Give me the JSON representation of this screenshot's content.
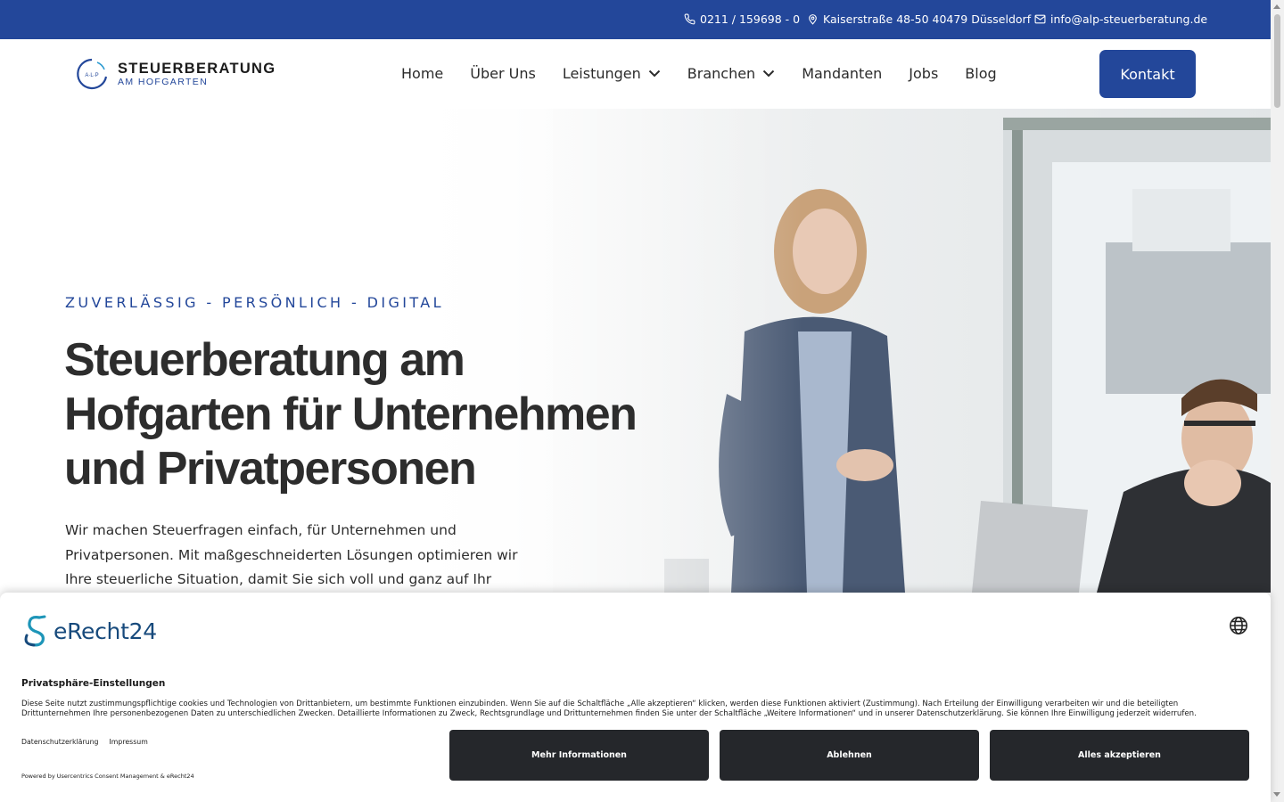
{
  "colors": {
    "primary": "#23479a",
    "dark_button": "#25272b",
    "brand_teal": "#174a7c"
  },
  "topbar": {
    "phone": "0211 / 159698 - 0",
    "address": "Kaiserstraße 48-50 40479 Düsseldorf",
    "email": "info@alp-steuerberatung.de",
    "icons": {
      "phone": "phone-icon",
      "address": "map-pin-icon",
      "email": "mail-icon"
    }
  },
  "logo": {
    "monogram": "A·L·P",
    "line1": "STEUERBERATUNG",
    "line2": "AM HOFGARTEN"
  },
  "nav": {
    "items": [
      {
        "label": "Home"
      },
      {
        "label": "Über Uns"
      },
      {
        "label": "Leistungen",
        "dropdown": true
      },
      {
        "label": "Branchen",
        "dropdown": true
      },
      {
        "label": "Mandanten"
      },
      {
        "label": "Jobs"
      },
      {
        "label": "Blog"
      }
    ],
    "cta": "Kontakt"
  },
  "hero": {
    "eyebrow": "ZUVERLÄSSIG - PERSÖNLICH - DIGITAL",
    "title": "Steuerberatung am Hofgarten für Unternehmen und Privatpersonen",
    "text": "Wir machen Steuerfragen einfach, für Unternehmen und Privatpersonen. Mit maßgeschneiderten Lösungen optimieren wir Ihre steuerliche Situation, damit Sie sich voll und ganz auf Ihr"
  },
  "consent": {
    "brand": "eRecht24",
    "title": "Privatsphäre-Einstellungen",
    "text": "Diese Seite nutzt zustimmungspflichtige cookies und Technologien von Drittanbietern, um bestimmte Funktionen einzubinden. Wenn Sie auf die Schaltfläche „Alle akzeptieren“ klicken, werden diese Funktionen aktiviert (Zustimmung). Nach Erteilung der Einwilligung verarbeiten wir und die beteiligten Drittunternehmen Ihre personenbezogenen Daten zu unterschiedlichen Zwecken. Detaillierte Informationen zu Zweck, Rechtsgrundlage und Drittunternehmen finden Sie unter der Schaltfläche „Weitere Informationen“ und in unserer Datenschutzerklärung. Sie können Ihre Einwilligung jederzeit widerrufen.",
    "link_privacy": "Datenschutzerklärung",
    "link_imprint": "Impressum",
    "powered": "Powered by Usercentrics Consent Management & eRecht24",
    "btn_more": "Mehr Informationen",
    "btn_decline": "Ablehnen",
    "btn_accept": "Alles akzeptieren"
  }
}
